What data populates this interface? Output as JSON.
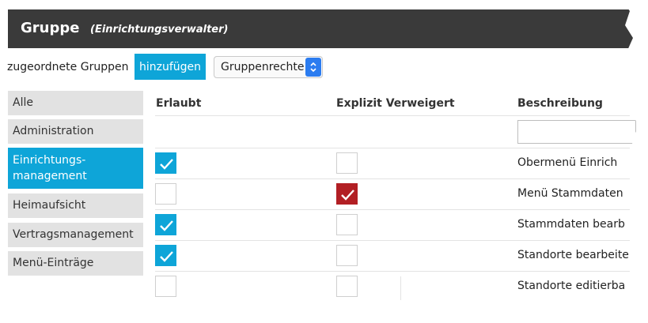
{
  "header": {
    "title": "Gruppe",
    "subtitle": "(Einrichtungsverwalter)"
  },
  "toolbar": {
    "groups_label": "zugeordnete Gruppen",
    "add_label": "hinzufügen",
    "select_value": "Gruppenrechte"
  },
  "sidebar": {
    "items": [
      {
        "label": "Alle"
      },
      {
        "label": "Administration"
      },
      {
        "label": "Einrichtungs-",
        "label2": "management",
        "active": true
      },
      {
        "label": "Heimaufsicht"
      },
      {
        "label": "Vertragsmanagement"
      },
      {
        "label": "Menü-Einträge"
      }
    ]
  },
  "table": {
    "headers": {
      "allowed": "Erlaubt",
      "denied": "Explizit Verweigert",
      "description": "Beschreibung"
    },
    "filter_value": "",
    "rows": [
      {
        "allowed": true,
        "denied": false,
        "description": "Obermenü Einrich"
      },
      {
        "allowed": false,
        "denied": true,
        "description": "Menü Stammdaten"
      },
      {
        "allowed": true,
        "denied": false,
        "description": "Stammdaten bearb"
      },
      {
        "allowed": true,
        "denied": false,
        "description": "Standorte bearbeite"
      },
      {
        "allowed": false,
        "denied": false,
        "description": "Standorte editierba"
      }
    ]
  },
  "colors": {
    "accent": "#0ea5d8",
    "deny": "#b21f24",
    "header_bg": "#3a3a3a",
    "select_arrow": "#2b7cf0"
  },
  "icons": {
    "check": "checkmark-icon",
    "select": "updown-chevron-icon"
  }
}
